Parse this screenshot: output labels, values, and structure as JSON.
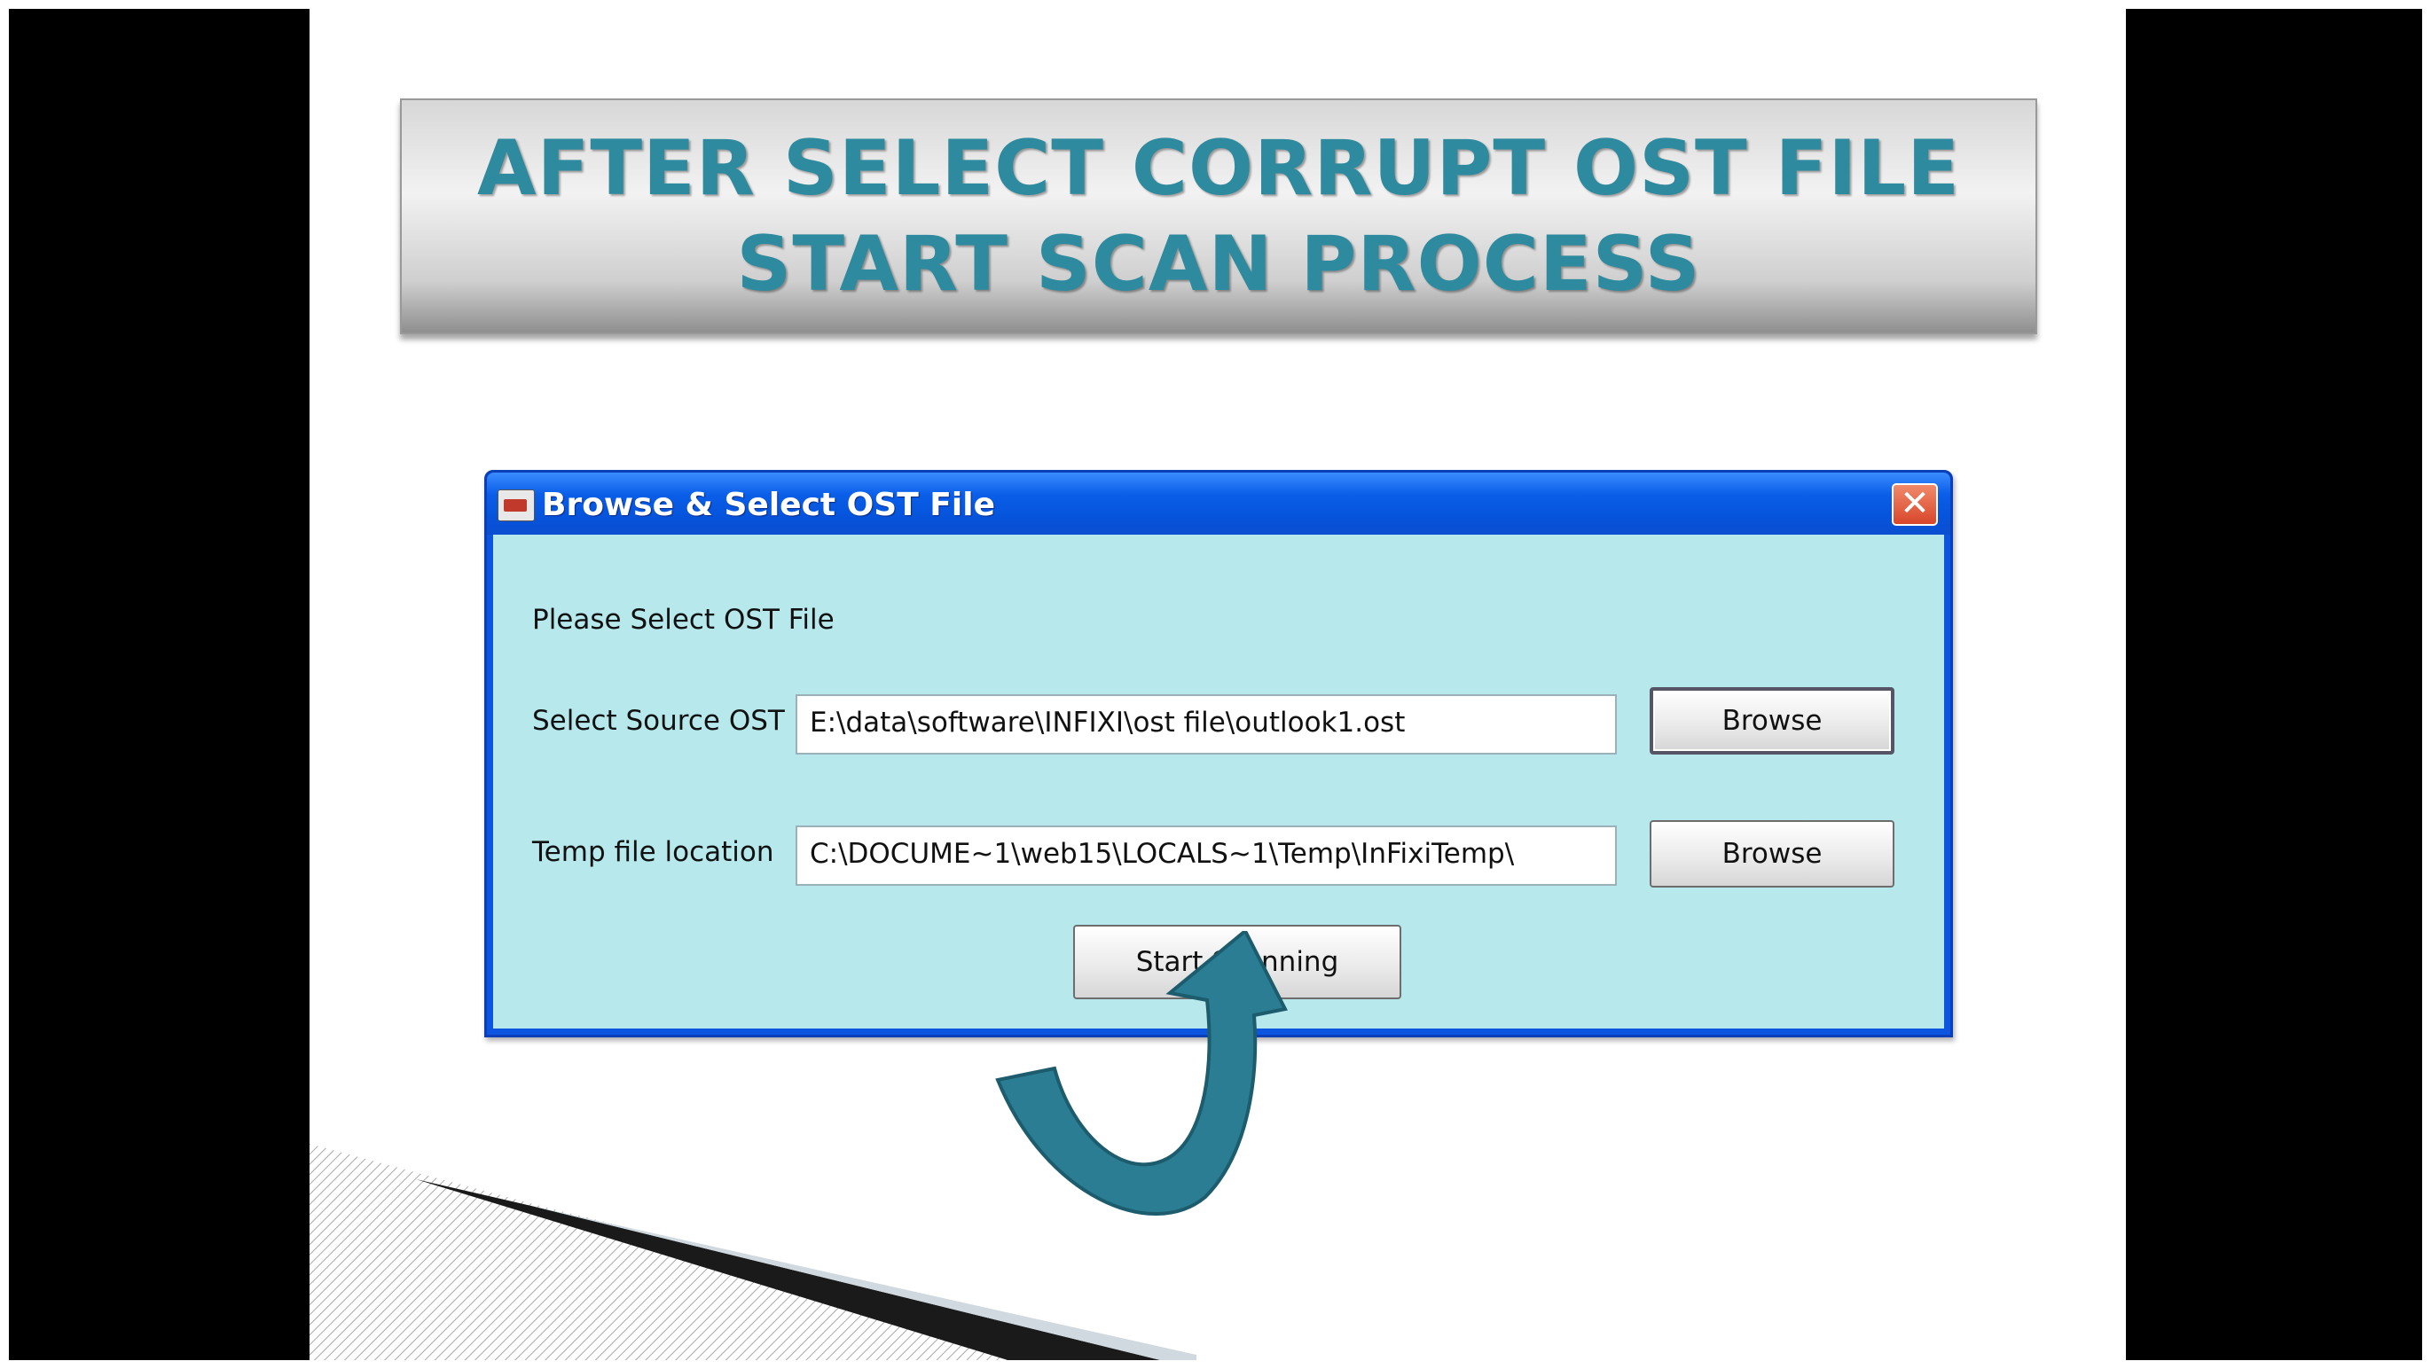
{
  "slide": {
    "title_line1": "AFTER SELECT CORRUPT OST FILE",
    "title_line2": "START SCAN PROCESS"
  },
  "dialog": {
    "title": "Browse & Select OST File",
    "close_glyph": "✕",
    "instruction": "Please Select OST File",
    "source_label": "Select Source OST",
    "source_value": "E:\\data\\software\\INFIXI\\ost file\\outlook1.ost",
    "temp_label": "Temp file location",
    "temp_value": "C:\\DOCUME~1\\web15\\LOCALS~1\\Temp\\InFixiTemp\\",
    "browse_label": "Browse",
    "browse_label_2": "Browse",
    "start_label": "Start Scanning"
  },
  "colors": {
    "title_text": "#2e8a9e",
    "dialog_frame": "#0c55e0",
    "dialog_body": "#b7e8ec",
    "arrow": "#2a7d92"
  },
  "icons": {
    "app": "app-icon",
    "close": "close-icon",
    "arrow": "curved-arrow-icon"
  }
}
